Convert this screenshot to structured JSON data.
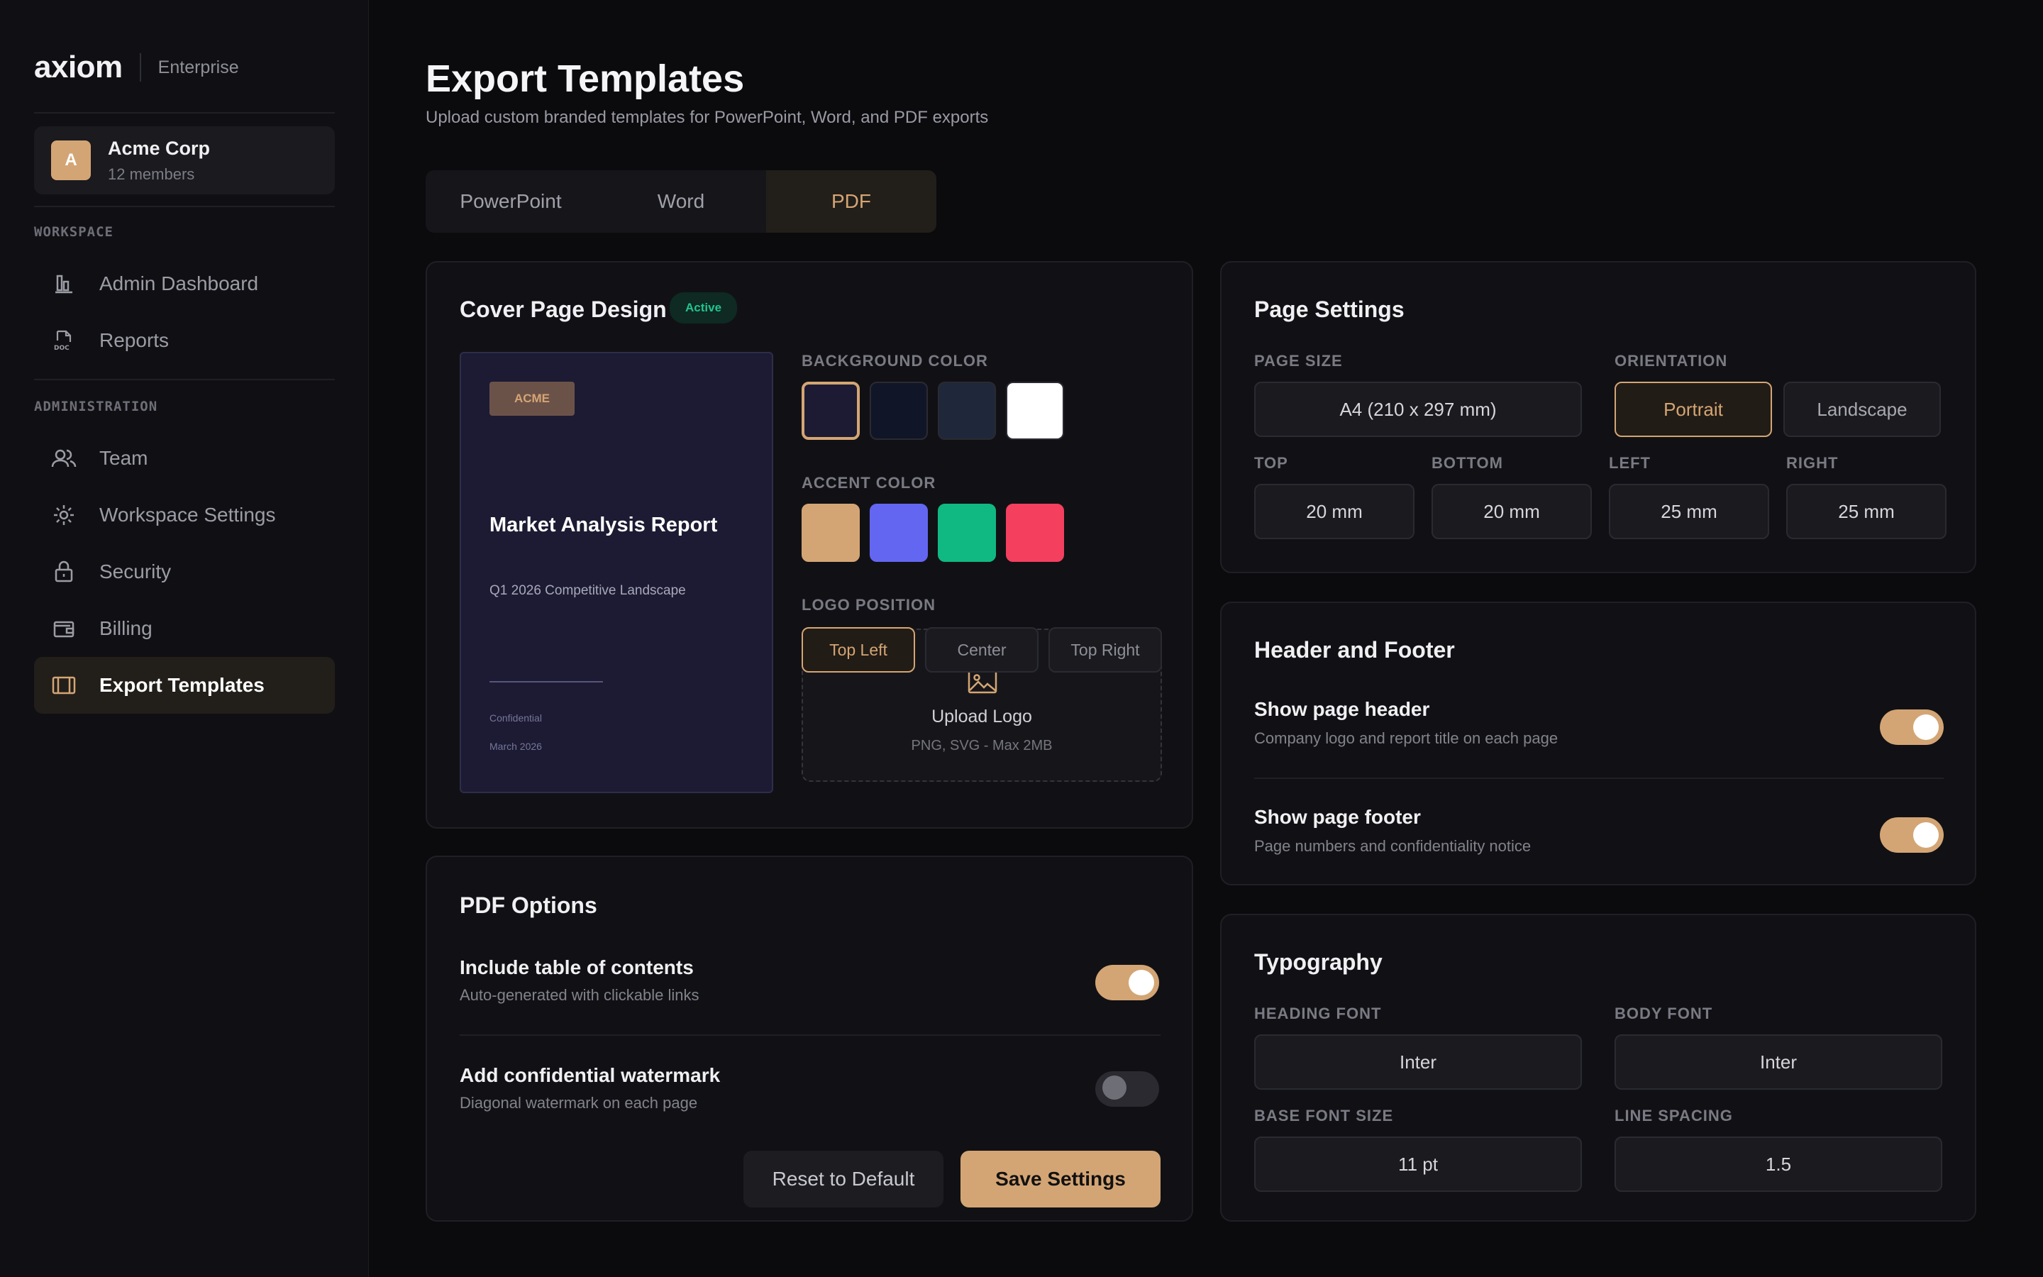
{
  "brand": {
    "logo": "axiom",
    "plan": "Enterprise"
  },
  "org": {
    "initial": "A",
    "name": "Acme Corp",
    "members": "12 members"
  },
  "sidebar": {
    "sections": [
      {
        "label": "WORKSPACE"
      },
      {
        "label": "ADMINISTRATION"
      }
    ],
    "items": [
      {
        "label": "Admin Dashboard",
        "icon": "chart-bars-icon"
      },
      {
        "label": "Reports",
        "icon": "doc-icon"
      },
      {
        "label": "Team",
        "icon": "users-icon"
      },
      {
        "label": "Workspace Settings",
        "icon": "gear-icon"
      },
      {
        "label": "Security",
        "icon": "lock-icon"
      },
      {
        "label": "Billing",
        "icon": "wallet-icon"
      },
      {
        "label": "Export Templates",
        "icon": "template-icon",
        "active": true
      }
    ]
  },
  "page": {
    "title": "Export Templates",
    "subtitle": "Upload custom branded templates for PowerPoint, Word, and PDF exports"
  },
  "tabs": [
    {
      "label": "PowerPoint"
    },
    {
      "label": "Word"
    },
    {
      "label": "PDF",
      "active": true
    }
  ],
  "cover": {
    "title": "Cover Page Design",
    "badge": "Active",
    "preview": {
      "logo": "ACME",
      "title": "Market Analysis Report",
      "subtitle": "Q1 2026 Competitive Landscape",
      "footer1": "Confidential",
      "footer2": "March 2026"
    },
    "bg_label": "BACKGROUND COLOR",
    "bg_colors": [
      "#1c1b33",
      "#101628",
      "#1e283a",
      "#ffffff"
    ],
    "accent_label": "ACCENT COLOR",
    "accent_colors": [
      "#d4a574",
      "#6366f1",
      "#10b981",
      "#f43f5e"
    ],
    "logo_label": "LOGO POSITION",
    "logo_positions": [
      "Top Left",
      "Center",
      "Top Right"
    ],
    "upload_title": "Upload Logo",
    "upload_sub": "PNG, SVG - Max 2MB"
  },
  "page_settings": {
    "title": "Page Settings",
    "size_label": "PAGE SIZE",
    "size_value": "A4 (210 x 297 mm)",
    "orientation_label": "ORIENTATION",
    "orientation": [
      "Portrait",
      "Landscape"
    ],
    "margins": [
      {
        "label": "TOP",
        "value": "20 mm"
      },
      {
        "label": "BOTTOM",
        "value": "20 mm"
      },
      {
        "label": "LEFT",
        "value": "25 mm"
      },
      {
        "label": "RIGHT",
        "value": "25 mm"
      }
    ]
  },
  "header_footer": {
    "title": "Header and Footer",
    "rows": [
      {
        "title": "Show page header",
        "sub": "Company logo and report title on each page",
        "on": true
      },
      {
        "title": "Show page footer",
        "sub": "Page numbers and confidentiality notice",
        "on": true
      }
    ]
  },
  "pdf_options": {
    "title": "PDF Options",
    "rows": [
      {
        "title": "Include table of contents",
        "sub": "Auto-generated with clickable links",
        "on": true
      },
      {
        "title": "Add confidential watermark",
        "sub": "Diagonal watermark on each page",
        "on": false
      }
    ],
    "reset": "Reset to Default",
    "save": "Save Settings"
  },
  "typography": {
    "title": "Typography",
    "heading_label": "HEADING FONT",
    "heading_value": "Inter",
    "body_label": "BODY FONT",
    "body_value": "Inter",
    "size_label": "BASE FONT SIZE",
    "size_value": "11 pt",
    "spacing_label": "LINE SPACING",
    "spacing_value": "1.5"
  },
  "colors": {
    "accent": "#d4a574",
    "success": "#22c38e"
  }
}
